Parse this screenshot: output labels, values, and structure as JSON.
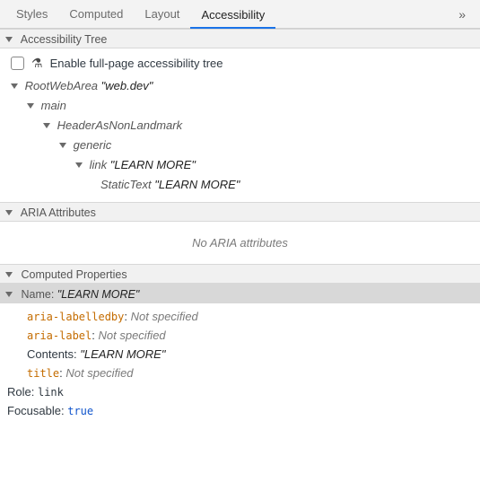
{
  "tabs": {
    "styles": "Styles",
    "computed": "Computed",
    "layout": "Layout",
    "accessibility": "Accessibility",
    "overflow": "»"
  },
  "sections": {
    "tree_header": "Accessibility Tree",
    "aria_header": "ARIA Attributes",
    "computed_header": "Computed Properties"
  },
  "checkbox_label": "Enable full-page accessibility tree",
  "tree": {
    "n0_role": "RootWebArea",
    "n0_name": "\"web.dev\"",
    "n1_role": "main",
    "n2_role": "HeaderAsNonLandmark",
    "n3_role": "generic",
    "n4_role": "link",
    "n4_name": "\"LEARN MORE\"",
    "n5_role": "StaticText",
    "n5_name": "\"LEARN MORE\""
  },
  "aria_empty": "No ARIA attributes",
  "props": {
    "name_label": "Name:",
    "name_value": "\"LEARN MORE\"",
    "al_key": "aria-labelledby",
    "al_val": "Not specified",
    "alabel_key": "aria-label",
    "alabel_val": "Not specified",
    "contents_key": "Contents:",
    "contents_val": "\"LEARN MORE\"",
    "title_key": "title",
    "title_val": "Not specified",
    "role_key": "Role:",
    "role_val": "link",
    "focus_key": "Focusable:",
    "focus_val": "true"
  }
}
